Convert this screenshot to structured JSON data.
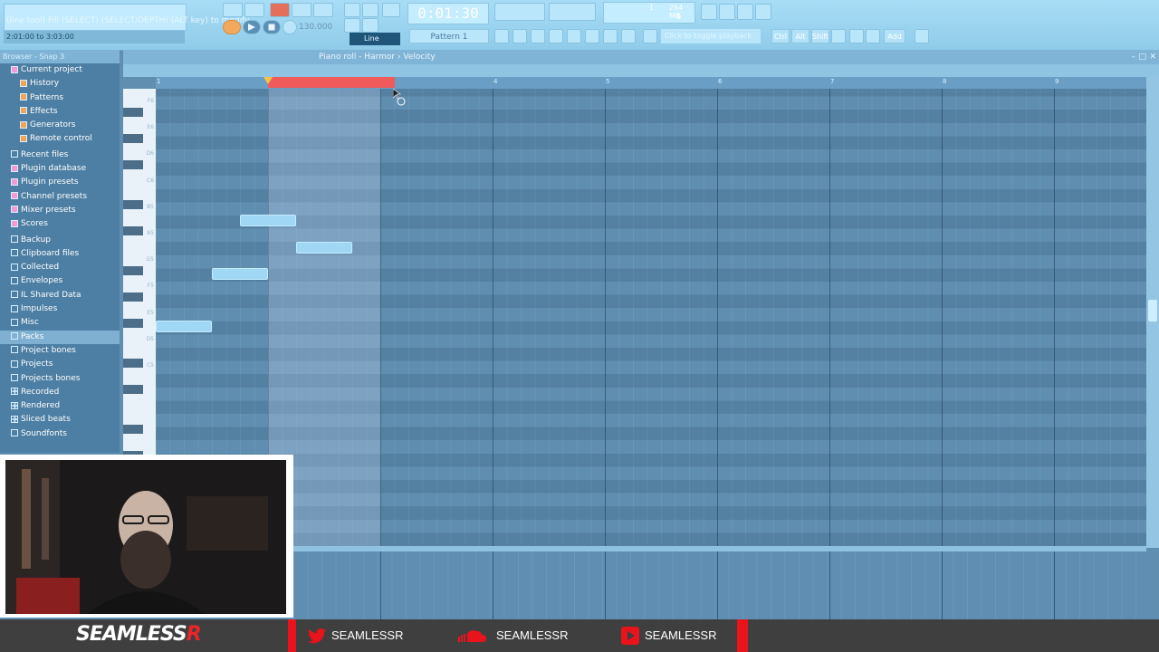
{
  "toolbar": {
    "hint_line": "(line  tool) Fill (SELECT) (SELECT/DEPTH) (ALT key) to modify",
    "time_range": "2:01:00 to 3:03:00",
    "song_time": "0:01:30",
    "tempo": "130.000",
    "pattern": "Pattern 1",
    "line_mode": "Line",
    "cpu_value": "1",
    "memory": "264 MB",
    "voices": "0",
    "hint_bar": "Click to toggle playback",
    "snap_buttons": [
      "Ctrl",
      "Alt",
      "Shift",
      "Add"
    ],
    "colors": {
      "accent": "#f05a5a",
      "bg": "#a9ddf6"
    }
  },
  "browser": {
    "header": "Browser - Snap 3",
    "items": [
      {
        "label": "Current project",
        "level": "top",
        "icon": "project-icon",
        "color": "#f29ad6"
      },
      {
        "label": "History",
        "level": "sub",
        "icon": "history-icon"
      },
      {
        "label": "Patterns",
        "level": "sub",
        "icon": "patterns-icon"
      },
      {
        "label": "Effects",
        "level": "sub",
        "icon": "effects-icon"
      },
      {
        "label": "Generators",
        "level": "sub",
        "icon": "generators-icon"
      },
      {
        "label": "Remote control",
        "level": "sub",
        "icon": "remote-control-icon"
      },
      {
        "label": "Recent files",
        "level": "top",
        "icon": "folder-icon"
      },
      {
        "label": "Plugin database",
        "level": "top",
        "icon": "plugin-icon"
      },
      {
        "label": "Plugin presets",
        "level": "top",
        "icon": "plugin-icon"
      },
      {
        "label": "Channel presets",
        "level": "top",
        "icon": "channel-icon"
      },
      {
        "label": "Mixer presets",
        "level": "top",
        "icon": "mixer-icon"
      },
      {
        "label": "Scores",
        "level": "top",
        "icon": "score-icon"
      },
      {
        "label": "Backup",
        "level": "top",
        "icon": "folder-icon"
      },
      {
        "label": "Clipboard files",
        "level": "top",
        "icon": "folder-icon"
      },
      {
        "label": "Collected",
        "level": "top",
        "icon": "folder-icon"
      },
      {
        "label": "Envelopes",
        "level": "top",
        "icon": "folder-icon"
      },
      {
        "label": "IL Shared Data",
        "level": "top",
        "icon": "folder-icon"
      },
      {
        "label": "Impulses",
        "level": "top",
        "icon": "folder-icon"
      },
      {
        "label": "Misc",
        "level": "top",
        "icon": "folder-icon"
      },
      {
        "label": "Packs",
        "level": "top",
        "icon": "folder-icon",
        "selected": true
      },
      {
        "label": "Project bones",
        "level": "top",
        "icon": "folder-icon"
      },
      {
        "label": "Projects",
        "level": "top",
        "icon": "folder-icon"
      },
      {
        "label": "Projects bones",
        "level": "top",
        "icon": "folder-icon"
      },
      {
        "label": "Recorded",
        "level": "top",
        "icon": "plus-icon"
      },
      {
        "label": "Rendered",
        "level": "top",
        "icon": "plus-icon"
      },
      {
        "label": "Sliced beats",
        "level": "top",
        "icon": "plus-icon"
      },
      {
        "label": "Soundfonts",
        "level": "top",
        "icon": "folder-icon"
      }
    ]
  },
  "piano_roll": {
    "breadcrumb": "Piano roll - Harmor › Velocity",
    "bar_numbers": [
      "1",
      "2",
      "3",
      "4",
      "5",
      "6",
      "7",
      "8",
      "9"
    ],
    "octave_labels": [
      "F6",
      "E6",
      "D6",
      "C6",
      "B5",
      "A5",
      "G5",
      "F5",
      "E5",
      "D5",
      "C5"
    ],
    "notes": [
      {
        "pitch_row": 17,
        "start_beat": 1.0,
        "length_beats": 2.0
      },
      {
        "pitch_row": 13,
        "start_beat": 3.0,
        "length_beats": 2.0
      },
      {
        "pitch_row": 9,
        "start_beat": 4.0,
        "length_beats": 2.0
      },
      {
        "pitch_row": 11,
        "start_beat": 6.0,
        "length_beats": 2.0
      }
    ],
    "loop_region": {
      "start_bar": 2.0,
      "end_bar": 3.1
    }
  },
  "social": {
    "logo_text": "SEAMLESS",
    "logo_r": "R",
    "twitter": "SEAMLESSR",
    "soundcloud": "SEAMLESSR",
    "youtube": "SEAMLESSR"
  }
}
